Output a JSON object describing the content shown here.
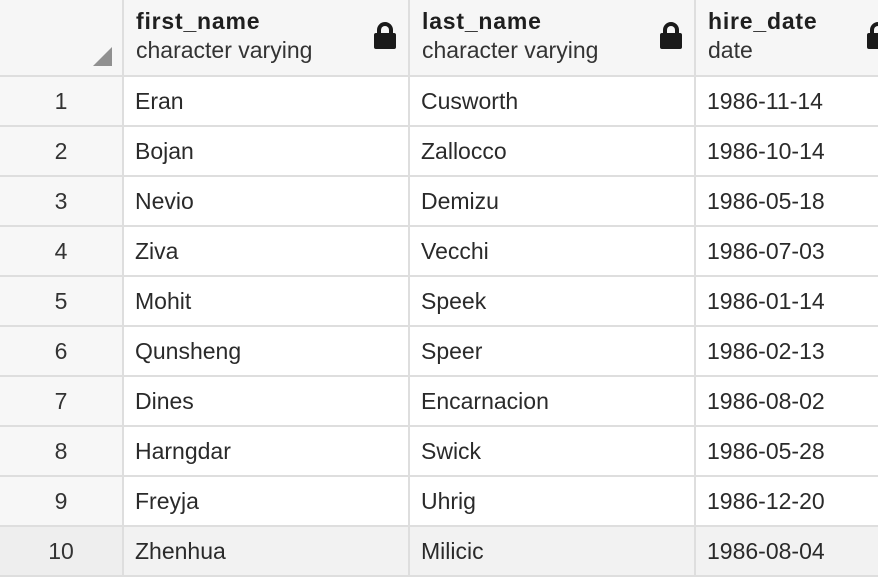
{
  "columns": [
    {
      "name": "first_name",
      "type": "character varying"
    },
    {
      "name": "last_name",
      "type": "character varying"
    },
    {
      "name": "hire_date",
      "type": "date"
    }
  ],
  "rows": [
    {
      "num": "1",
      "first_name": "Eran",
      "last_name": "Cusworth",
      "hire_date": "1986-11-14"
    },
    {
      "num": "2",
      "first_name": "Bojan",
      "last_name": "Zallocco",
      "hire_date": "1986-10-14"
    },
    {
      "num": "3",
      "first_name": "Nevio",
      "last_name": "Demizu",
      "hire_date": "1986-05-18"
    },
    {
      "num": "4",
      "first_name": "Ziva",
      "last_name": "Vecchi",
      "hire_date": "1986-07-03"
    },
    {
      "num": "5",
      "first_name": "Mohit",
      "last_name": "Speek",
      "hire_date": "1986-01-14"
    },
    {
      "num": "6",
      "first_name": "Qunsheng",
      "last_name": "Speer",
      "hire_date": "1986-02-13"
    },
    {
      "num": "7",
      "first_name": "Dines",
      "last_name": "Encarnacion",
      "hire_date": "1986-08-02"
    },
    {
      "num": "8",
      "first_name": "Harngdar",
      "last_name": "Swick",
      "hire_date": "1986-05-28"
    },
    {
      "num": "9",
      "first_name": "Freyja",
      "last_name": "Uhrig",
      "hire_date": "1986-12-20"
    },
    {
      "num": "10",
      "first_name": "Zhenhua",
      "last_name": "Milicic",
      "hire_date": "1986-08-04"
    }
  ],
  "icons": {
    "column_lock": "lock-icon",
    "corner": "select-all-triangle-icon"
  },
  "colors": {
    "header_bg": "#f6f6f6",
    "grid_line": "#dedede",
    "row_number_bg": "#f7f7f7",
    "lock": "#1a1a1a"
  }
}
